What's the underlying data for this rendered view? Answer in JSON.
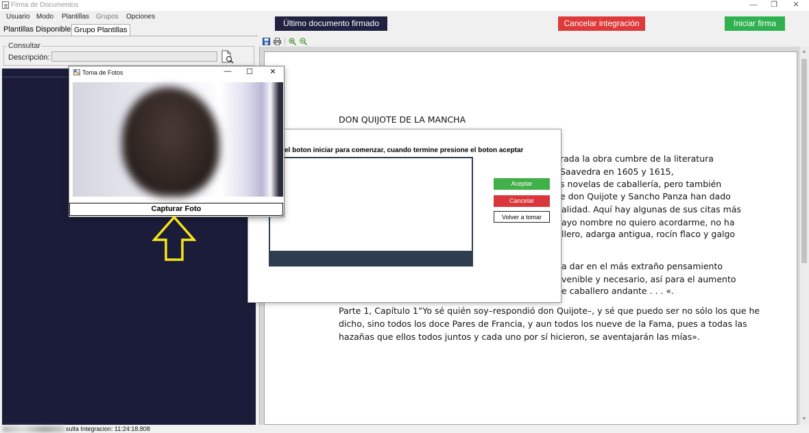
{
  "window": {
    "title": "Firma de Documentos",
    "controls": [
      "—",
      "❐",
      "✕"
    ]
  },
  "menu": {
    "items": [
      "Usuario",
      "Modo",
      "Plantillas",
      "Grupos",
      "Opciones"
    ]
  },
  "tabs": [
    "Plantillas Disponibles",
    "Grupo Plantillas"
  ],
  "consultar": {
    "legend": "Consultar",
    "description_label": "Descripción:",
    "description_value": ""
  },
  "actions": {
    "ultimo": "Último documento firmado",
    "cancelar": "Cancelar integración",
    "iniciar": "Iniciar firma"
  },
  "colors": {
    "ultimo": "#1f2240",
    "cancelar": "#de3a3a",
    "iniciar": "#2fb150",
    "left_panel": "#1b1c3a"
  },
  "document": {
    "heading": "DON QUIJOTE DE LA MANCHA",
    "lines_right": [
      "rada la obra cumbre de la literatura",
      "Saavedra en 1605 y 1615,",
      "s novelas de caballería, pero también",
      "e don Quijote y Sancho Panza han dado",
      "alidad. Aquí hay algunas de sus citas más",
      "ayo nombre no quiero acordarme, no ha",
      "llero, adarga antigua, rocín flaco y galgo",
      "a dar en el más extraño pensamiento",
      "venible y necesario, así para el aumento",
      "e caballero andante . . . «."
    ],
    "paragraph": [
      "Parte 1, Capítulo 1”Yo sé quién soy–respondió don Quijote–, y sé que puedo ser no sólo los que he",
      "dicho, sino todos los doce Pares de Francia, y aun todos los nueve de la Fama, pues a todas las",
      "hazañas que ellos todos juntos y cada uno por sí hicieron, se aventajarán las mías»."
    ]
  },
  "capture_dialog": {
    "instruction": "el boton iniciar para comenzar, cuando termine presione el boton aceptar",
    "aceptar": "Aceptar",
    "cancelar": "Cancelar",
    "volver": "Volver a tomar"
  },
  "photo_window": {
    "title": "Toma de Fotos",
    "controls": [
      "—",
      "☐",
      "✕"
    ],
    "capture_button": "Capturar Foto"
  },
  "status": {
    "text": "sulta Integracion: 11:24:18.808"
  }
}
